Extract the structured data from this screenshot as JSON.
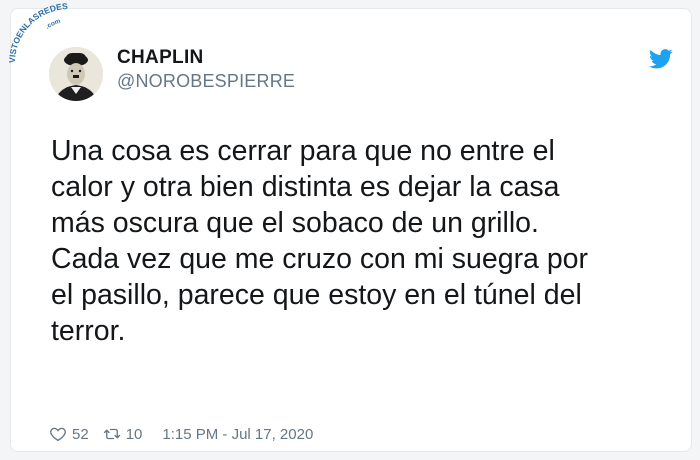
{
  "watermark": {
    "text": "VISTOENLASREDES",
    "domain": ".com"
  },
  "tweet": {
    "author_name": "CHAPLIN",
    "author_handle": "@NOROBESPIERRE",
    "text": "Una cosa es cerrar para que no entre el\ncalor y otra bien distinta es dejar la casa\nmás oscura que el sobaco de un grillo.\nCada vez que me cruzo con mi suegra por\nel pasillo, parece que estoy en el túnel del\nterror.",
    "likes": "52",
    "retweets": "10",
    "timestamp": "1:15 PM - Jul 17, 2020"
  },
  "icons": {
    "brand": "twitter-bird-icon",
    "like": "heart-icon",
    "retweet": "retweet-icon"
  },
  "colors": {
    "brand_blue": "#1da1f2",
    "text": "#14171a",
    "muted": "#657786"
  }
}
